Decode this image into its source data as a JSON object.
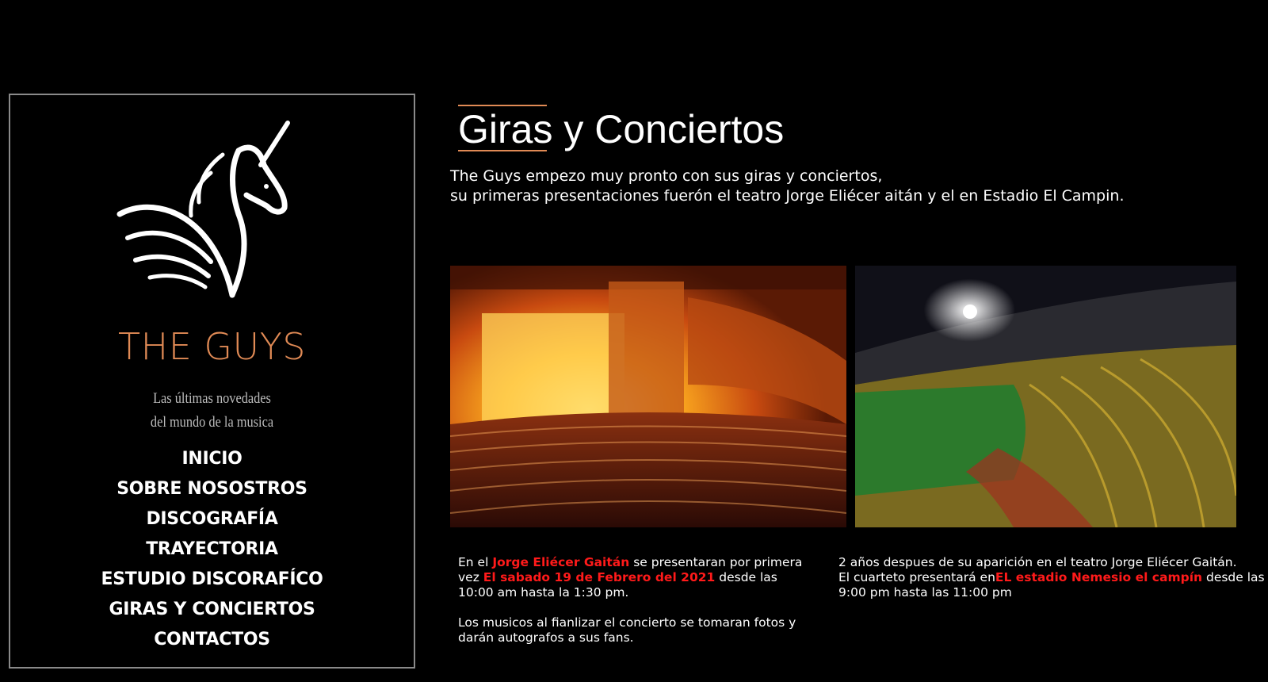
{
  "sidebar": {
    "brand": "THE GUYS",
    "tagline_line1": "Las últimas novedades",
    "tagline_line2": "del mundo de la musica",
    "logo_icon": "unicorn-logo-icon",
    "nav": [
      {
        "label": "INICIO"
      },
      {
        "label": "SOBRE NOSOSTROS"
      },
      {
        "label": "DISCOGRAFÍA"
      },
      {
        "label": "TRAYECTORIA"
      },
      {
        "label": "ESTUDIO DISCORAFÍCO"
      },
      {
        "label": "GIRAS Y CONCIERTOS"
      },
      {
        "label": "CONTACTOS"
      }
    ]
  },
  "main": {
    "title": "Giras y Conciertos",
    "intro_line1": "The Guys empezo muy pronto con sus giras y conciertos,",
    "intro_line2": "su primeras presentaciones fuerón el teatro Jorge Eliécer aitán y el en Estadio El Campin.",
    "photos": [
      {
        "name": "theater-photo"
      },
      {
        "name": "stadium-photo"
      }
    ],
    "caption_left": {
      "t1": "En el ",
      "h1": "Jorge Eliécer Gaitán",
      "t2": " se presentaran por primera vez ",
      "h2": "El sabado 19 de Febrero del 2021",
      "t3": " desde las 10:00 am hasta la 1:30 pm.",
      "p2": "Los musicos al fianlizar el concierto se tomaran fotos y darán autografos a sus fans."
    },
    "caption_right": {
      "line1": "2 años despues de su aparición en el teatro Jorge Eliécer Gaitán.",
      "t1": "El cuarteto presentará en",
      "h1": "EL estadio Nemesio el campín",
      "t2": " desde las 9:00 pm hasta las 11:00 pm"
    }
  },
  "colors": {
    "accent": "#e08a55",
    "highlight": "#ff1a1a",
    "background": "#000000"
  }
}
